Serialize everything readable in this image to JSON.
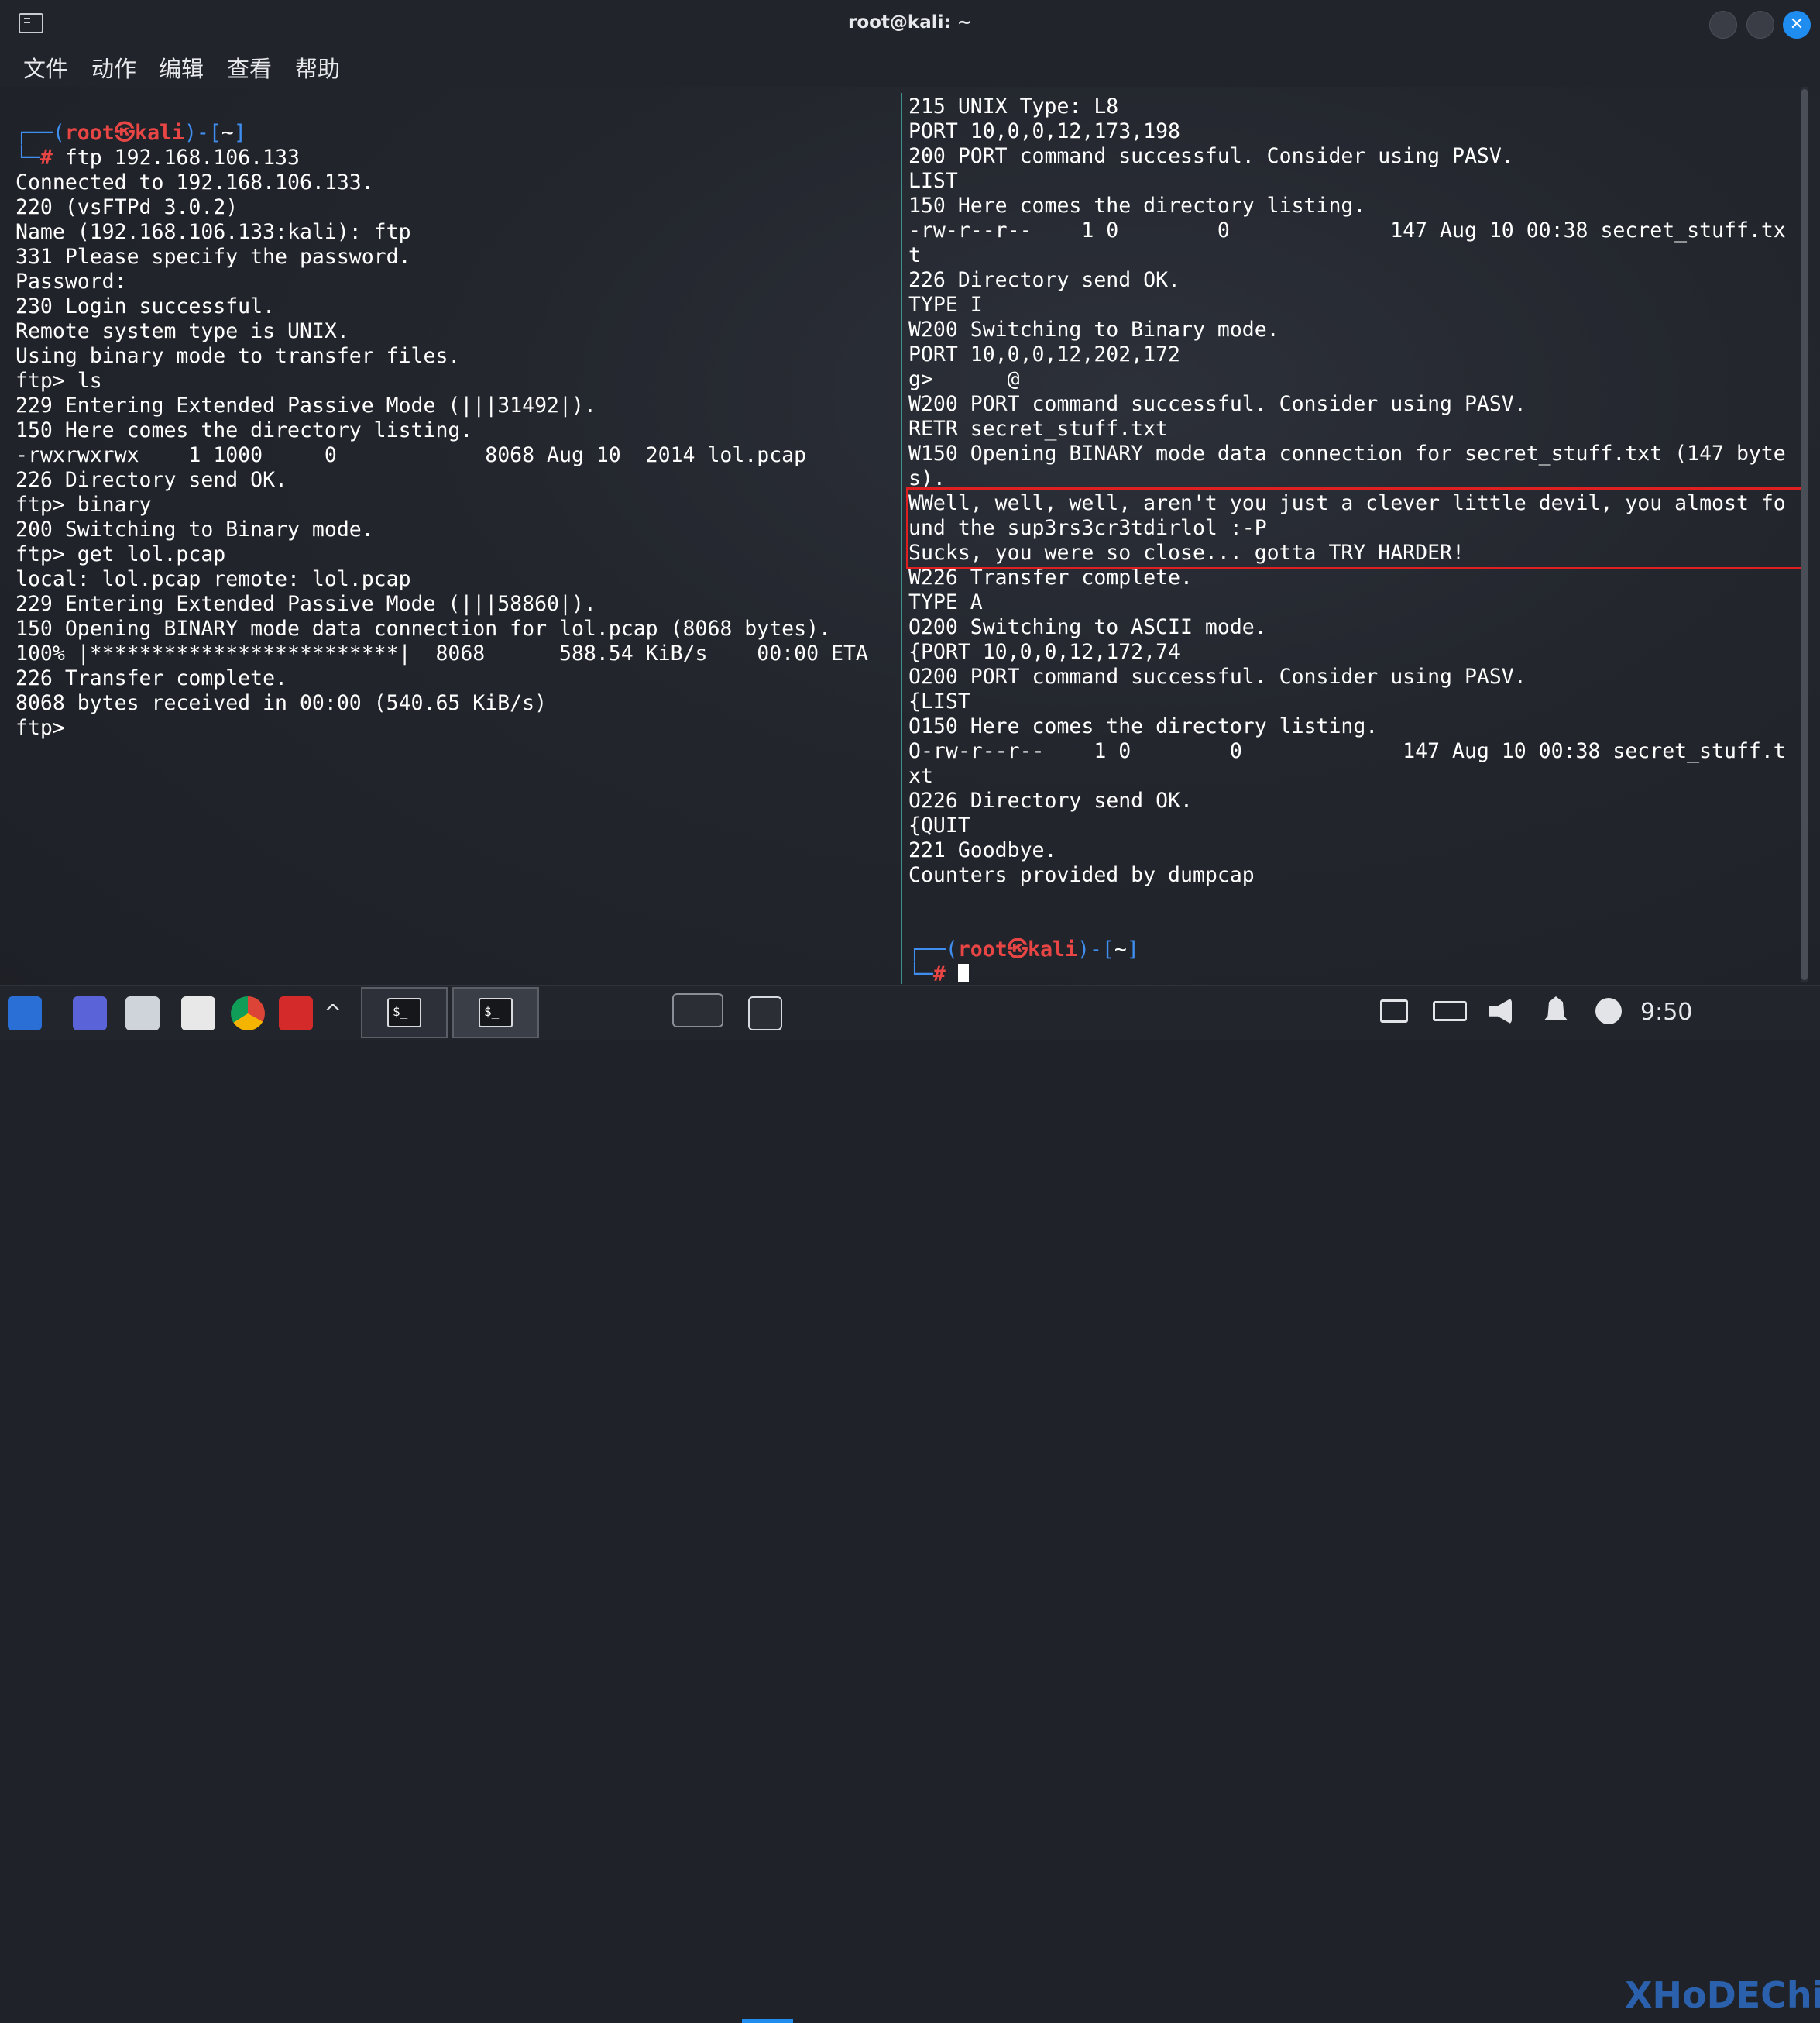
{
  "window": {
    "title": "root@kali: ~",
    "close_glyph": "✕"
  },
  "menu": [
    "文件",
    "动作",
    "编辑",
    "查看",
    "帮助"
  ],
  "left_terminal": {
    "prompt": {
      "open": "┌──(",
      "user": "root㉿kali",
      "mid": ")-[",
      "path": "~",
      "close": "]",
      "corner": "└─",
      "hash": "# ",
      "cmd": "ftp 192.168.106.133"
    },
    "lines": [
      "Connected to 192.168.106.133.",
      "220 (vsFTPd 3.0.2)",
      "Name (192.168.106.133:kali): ftp",
      "331 Please specify the password.",
      "Password:",
      "230 Login successful.",
      "Remote system type is UNIX.",
      "Using binary mode to transfer files.",
      "ftp> ls",
      "229 Entering Extended Passive Mode (|||31492|).",
      "150 Here comes the directory listing.",
      "-rwxrwxrwx    1 1000     0            8068 Aug 10  2014 lol.pcap",
      "226 Directory send OK.",
      "ftp> binary",
      "200 Switching to Binary mode.",
      "ftp> get lol.pcap",
      "local: lol.pcap remote: lol.pcap",
      "229 Entering Extended Passive Mode (|||58860|).",
      "150 Opening BINARY mode data connection for lol.pcap (8068 bytes).",
      "100% |*************************|  8068      588.54 KiB/s    00:00 ETA",
      "226 Transfer complete.",
      "8068 bytes received in 00:00 (540.65 KiB/s)",
      "ftp> "
    ]
  },
  "right_terminal": {
    "lines": [
      "215 UNIX Type: L8",
      "PORT 10,0,0,12,173,198",
      "200 PORT command successful. Consider using PASV.",
      "LIST",
      "150 Here comes the directory listing.",
      "-rw-r--r--    1 0        0             147 Aug 10 00:38 secret_stuff.tx",
      "t",
      "226 Directory send OK.",
      "TYPE I",
      "W200 Switching to Binary mode.",
      "PORT 10,0,0,12,202,172",
      "g>      @",
      "W200 PORT command successful. Consider using PASV.",
      "RETR secret_stuff.txt",
      "W150 Opening BINARY mode data connection for secret_stuff.txt (147 byte",
      "s).",
      "WWell, well, well, aren't you just a clever little devil, you almost fo",
      "und the sup3rs3cr3tdirlol :-P",
      "Sucks, you were so close... gotta TRY HARDER!",
      "W226 Transfer complete.",
      "TYPE A",
      "O200 Switching to ASCII mode.",
      "{PORT 10,0,0,12,172,74",
      "O200 PORT command successful. Consider using PASV.",
      "{LIST",
      "O150 Here comes the directory listing.",
      "O-rw-r--r--    1 0        0             147 Aug 10 00:38 secret_stuff.t",
      "xt",
      "O226 Directory send OK.",
      "{QUIT",
      "221 Goodbye.",
      "Counters provided by dumpcap",
      ""
    ],
    "prompt": {
      "open": "┌──(",
      "user": "root㉿kali",
      "mid": ")-[",
      "path": "~",
      "close": "]",
      "corner": "└─",
      "hash": "# "
    }
  },
  "taskbar": {
    "clock": "9:50",
    "watermark": "XHoDEChi",
    "caret": "^",
    "term_prompt": "$_"
  },
  "colors": {
    "prompt_blue": "#3f8ef0",
    "prompt_red": "#e84545",
    "highlight_box": "#e02020",
    "accent": "#1f8cf0"
  }
}
